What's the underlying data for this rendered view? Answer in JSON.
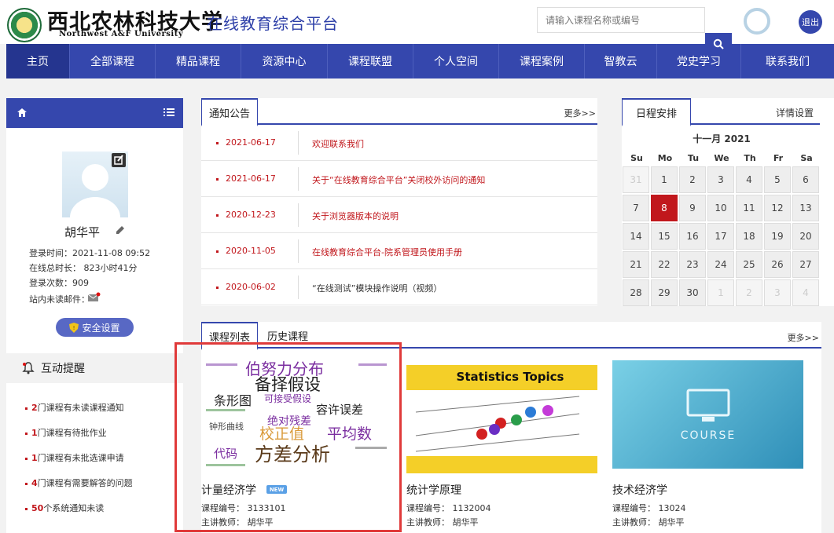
{
  "header": {
    "logo_cn": "西北农林科技大学",
    "logo_en": "Northwest A&F University",
    "platform": "在线教育综合平台",
    "search_placeholder": "请输入课程名称或编号",
    "logout": "退出"
  },
  "nav": [
    "主页",
    "全部课程",
    "精品课程",
    "资源中心",
    "课程联盟",
    "个人空间",
    "课程案例",
    "智教云",
    "党史学习",
    "联系我们"
  ],
  "profile": {
    "name": "胡华平",
    "login_time": "登录时间：2021-11-08 09:52",
    "online_time": "在线总时长：  823小时41分",
    "login_count": "登录次数：909",
    "mail": "站内未读邮件：",
    "security": "安全设置"
  },
  "reminders": {
    "title": "互动提醒",
    "items": [
      {
        "num": "2",
        "text": "门课程有未读课程通知"
      },
      {
        "num": "1",
        "text": "门课程有待批作业"
      },
      {
        "num": "1",
        "text": "门课程有未批选课申请"
      },
      {
        "num": "4",
        "text": "门课程有需要解答的问题"
      },
      {
        "num": "50",
        "text": "个系统通知未读"
      }
    ]
  },
  "notices": {
    "tab": "通知公告",
    "more": "更多>>",
    "items": [
      {
        "date": "2021-06-17",
        "title": "欢迎联系我们"
      },
      {
        "date": "2021-06-17",
        "title": "关于“在线教育综合平台”关闭校外访问的通知"
      },
      {
        "date": "2020-12-23",
        "title": "关于浏览器版本的说明"
      },
      {
        "date": "2020-11-05",
        "title": "在线教育综合平台-院系管理员使用手册"
      },
      {
        "date": "2020-06-02",
        "title": "“在线测试”模块操作说明（视频）"
      }
    ]
  },
  "calendar": {
    "tab": "日程安排",
    "settings": "详情设置",
    "month": "十一月 2021",
    "weekdays": [
      "Su",
      "Mo",
      "Tu",
      "We",
      "Th",
      "Fr",
      "Sa"
    ],
    "days": [
      "31",
      "1",
      "2",
      "3",
      "4",
      "5",
      "6",
      "7",
      "8",
      "9",
      "10",
      "11",
      "12",
      "13",
      "14",
      "15",
      "16",
      "17",
      "18",
      "19",
      "20",
      "21",
      "22",
      "23",
      "24",
      "25",
      "26",
      "27",
      "28",
      "29",
      "30",
      "1",
      "2",
      "3",
      "4"
    ],
    "today": "8"
  },
  "courses": {
    "tab_active": "课程列表",
    "tab_other": "历史课程",
    "more": "更多>>",
    "new_badge": "NEW",
    "items": [
      {
        "name": "计量经济学",
        "code": "课程编号：  3133101",
        "teacher": "主讲教师：  胡华平"
      },
      {
        "name": "统计学原理",
        "code": "课程编号：  1132004",
        "teacher": "主讲教师：  胡华平"
      },
      {
        "name": "技术经济学",
        "code": "课程编号：  13024",
        "teacher": "主讲教师：  胡华平"
      }
    ],
    "wordcloud": [
      "伯努力分布",
      "备择假设",
      "条形图",
      "可接受假设",
      "容许误差",
      "绝对残差",
      "校正值",
      "平均数",
      "方差分析",
      "代码",
      "钟形曲线"
    ],
    "stats_title": "Statistics Topics",
    "course_img_text": "COURSE"
  }
}
